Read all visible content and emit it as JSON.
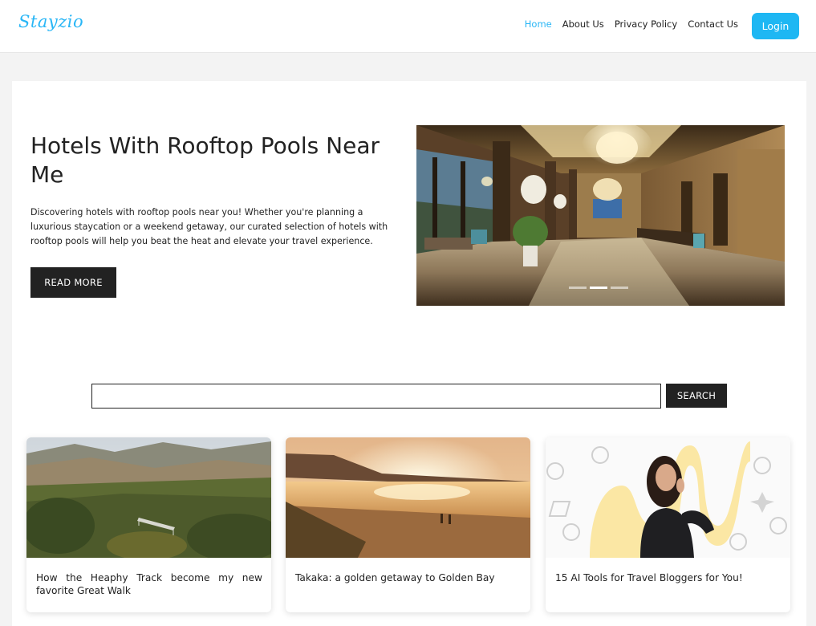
{
  "header": {
    "logo": "Stayzio",
    "nav": [
      {
        "label": "Home",
        "active": true
      },
      {
        "label": "About Us",
        "active": false
      },
      {
        "label": "Privacy Policy",
        "active": false
      },
      {
        "label": "Contact Us",
        "active": false
      }
    ],
    "login_label": "Login",
    "accent_color": "#29b6f6"
  },
  "hero": {
    "title": "Hotels With Rooftop Pools Near Me",
    "text": "Discovering hotels with rooftop pools near you! Whether you're planning a luxurious staycation or a weekend getaway, our curated selection of hotels with rooftop pools will help you beat the heat and elevate your travel experience.",
    "button_label": "READ MORE",
    "image": "hotel-lobby-image",
    "slides": 3,
    "active_slide": 2
  },
  "search": {
    "placeholder": "",
    "value": "",
    "button_label": "SEARCH"
  },
  "cards": [
    {
      "title": "How the Heaphy Track become my new favorite Great Walk",
      "image": "mountain-track-image"
    },
    {
      "title": "Takaka: a golden getaway to Golden Bay",
      "image": "golden-beach-sunset-image"
    },
    {
      "title": "15 AI Tools for Travel Bloggers for You!",
      "image": "ai-tools-blogger-image"
    }
  ]
}
